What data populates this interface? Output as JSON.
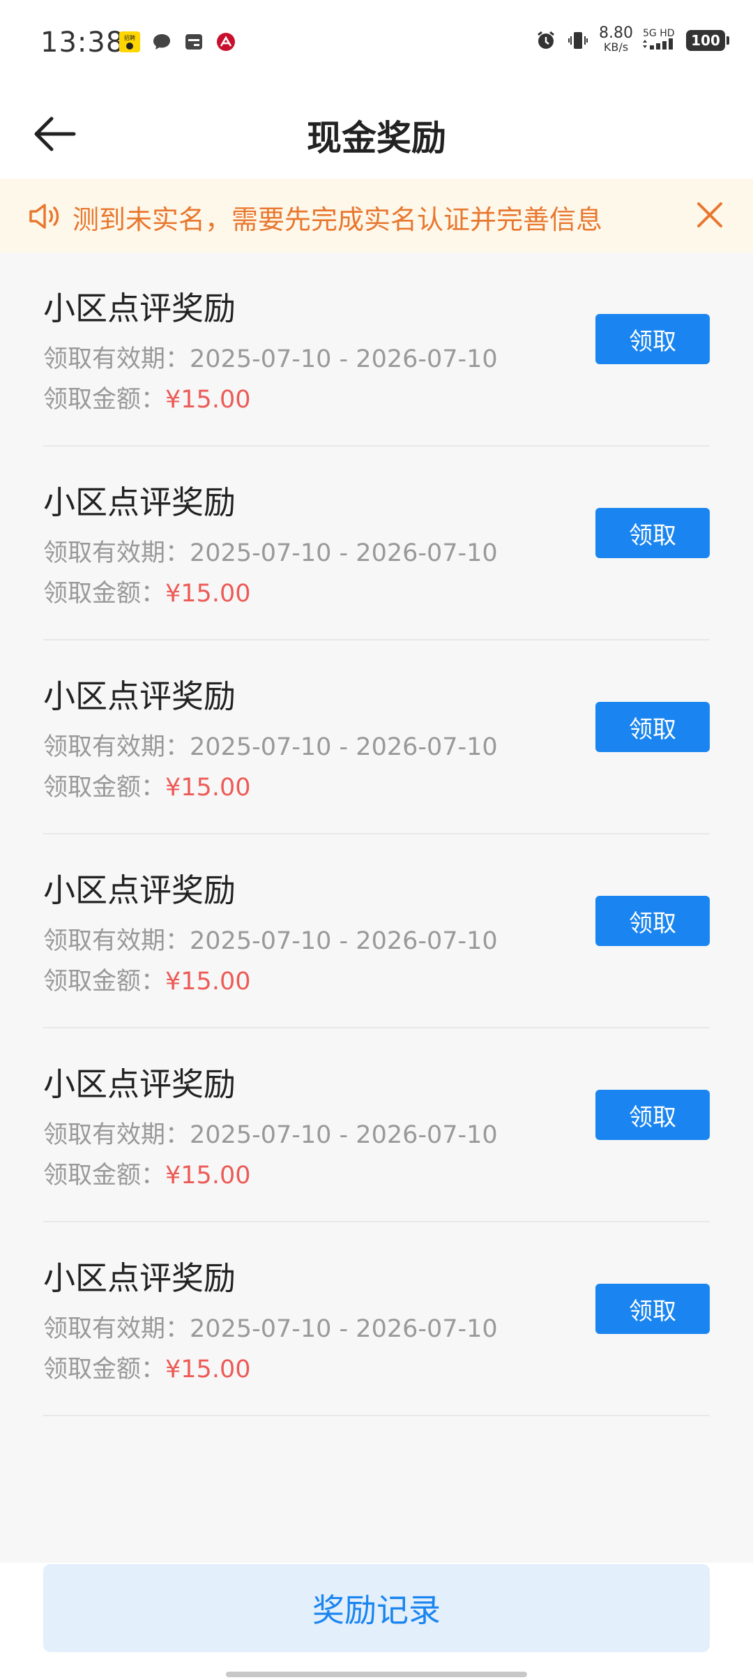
{
  "status_bar": {
    "time": "13:38",
    "net_speed_value": "8.80",
    "net_speed_unit": "KB/s",
    "signal_label": "5G HD",
    "battery": "100",
    "app_badge_text": "招聘"
  },
  "header": {
    "title": "现金奖励"
  },
  "notice": {
    "text": "测到未实名，需要先完成实名认证并完善信息"
  },
  "rewards": [
    {
      "title": "小区点评奖励",
      "period_label": "领取有效期：",
      "period": "2025-07-10 - 2026-07-10",
      "amount_label": "领取金额：",
      "amount": "¥15.00",
      "button": "领取"
    },
    {
      "title": "小区点评奖励",
      "period_label": "领取有效期：",
      "period": "2025-07-10 - 2026-07-10",
      "amount_label": "领取金额：",
      "amount": "¥15.00",
      "button": "领取"
    },
    {
      "title": "小区点评奖励",
      "period_label": "领取有效期：",
      "period": "2025-07-10 - 2026-07-10",
      "amount_label": "领取金额：",
      "amount": "¥15.00",
      "button": "领取"
    },
    {
      "title": "小区点评奖励",
      "period_label": "领取有效期：",
      "period": "2025-07-10 - 2026-07-10",
      "amount_label": "领取金额：",
      "amount": "¥15.00",
      "button": "领取"
    },
    {
      "title": "小区点评奖励",
      "period_label": "领取有效期：",
      "period": "2025-07-10 - 2026-07-10",
      "amount_label": "领取金额：",
      "amount": "¥15.00",
      "button": "领取"
    },
    {
      "title": "小区点评奖励",
      "period_label": "领取有效期：",
      "period": "2025-07-10 - 2026-07-10",
      "amount_label": "领取金额：",
      "amount": "¥15.00",
      "button": "领取"
    }
  ],
  "bottom": {
    "record_button": "奖励记录"
  },
  "icons": {
    "back": "arrow-left-icon",
    "notice": "speaker-icon",
    "close": "close-icon"
  },
  "colors": {
    "accent_blue": "#1a85f0",
    "notice_orange": "#e8772f",
    "notice_bg": "#fef8ea",
    "amount_red": "#ec5b57",
    "record_bg": "#e3effb"
  }
}
